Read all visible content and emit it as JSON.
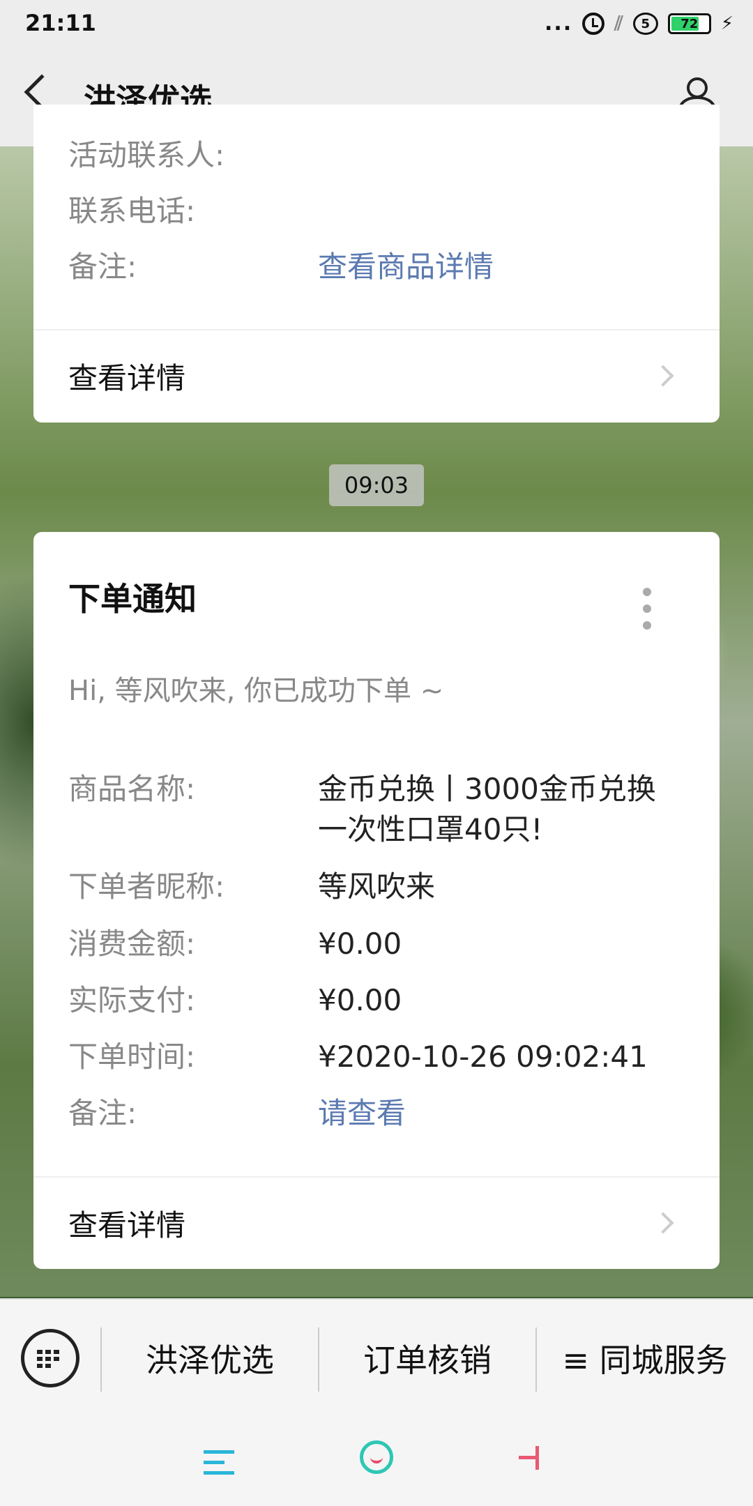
{
  "status_bar": {
    "time": "21:11",
    "signal_dots": "...",
    "network": "5G",
    "battery": "72"
  },
  "nav": {
    "title": "洪泽优选"
  },
  "card1": {
    "rows": [
      {
        "label": "活动联系人:",
        "value": ""
      },
      {
        "label": "联系电话:",
        "value": ""
      },
      {
        "label": "备注:",
        "value": "查看商品详情"
      }
    ],
    "detail_label": "查看详情"
  },
  "time_badge": "09:03",
  "card2": {
    "title": "下单通知",
    "greeting": "Hi, 等风吹来, 你已成功下单 ~",
    "rows": [
      {
        "label": "商品名称:",
        "value": "金币兑换丨3000金币兑换一次性口罩40只!"
      },
      {
        "label": "下单者昵称:",
        "value": "等风吹来"
      },
      {
        "label": "消费金额:",
        "value": "¥0.00"
      },
      {
        "label": "实际支付:",
        "value": "¥0.00"
      },
      {
        "label": "下单时间:",
        "value": "¥2020-10-26 09:02:41"
      },
      {
        "label": "备注:",
        "value": "请查看"
      }
    ],
    "detail_label": "查看详情"
  },
  "menu": {
    "items": [
      "洪泽优选",
      "订单核销",
      "≡ 同城服务"
    ]
  }
}
